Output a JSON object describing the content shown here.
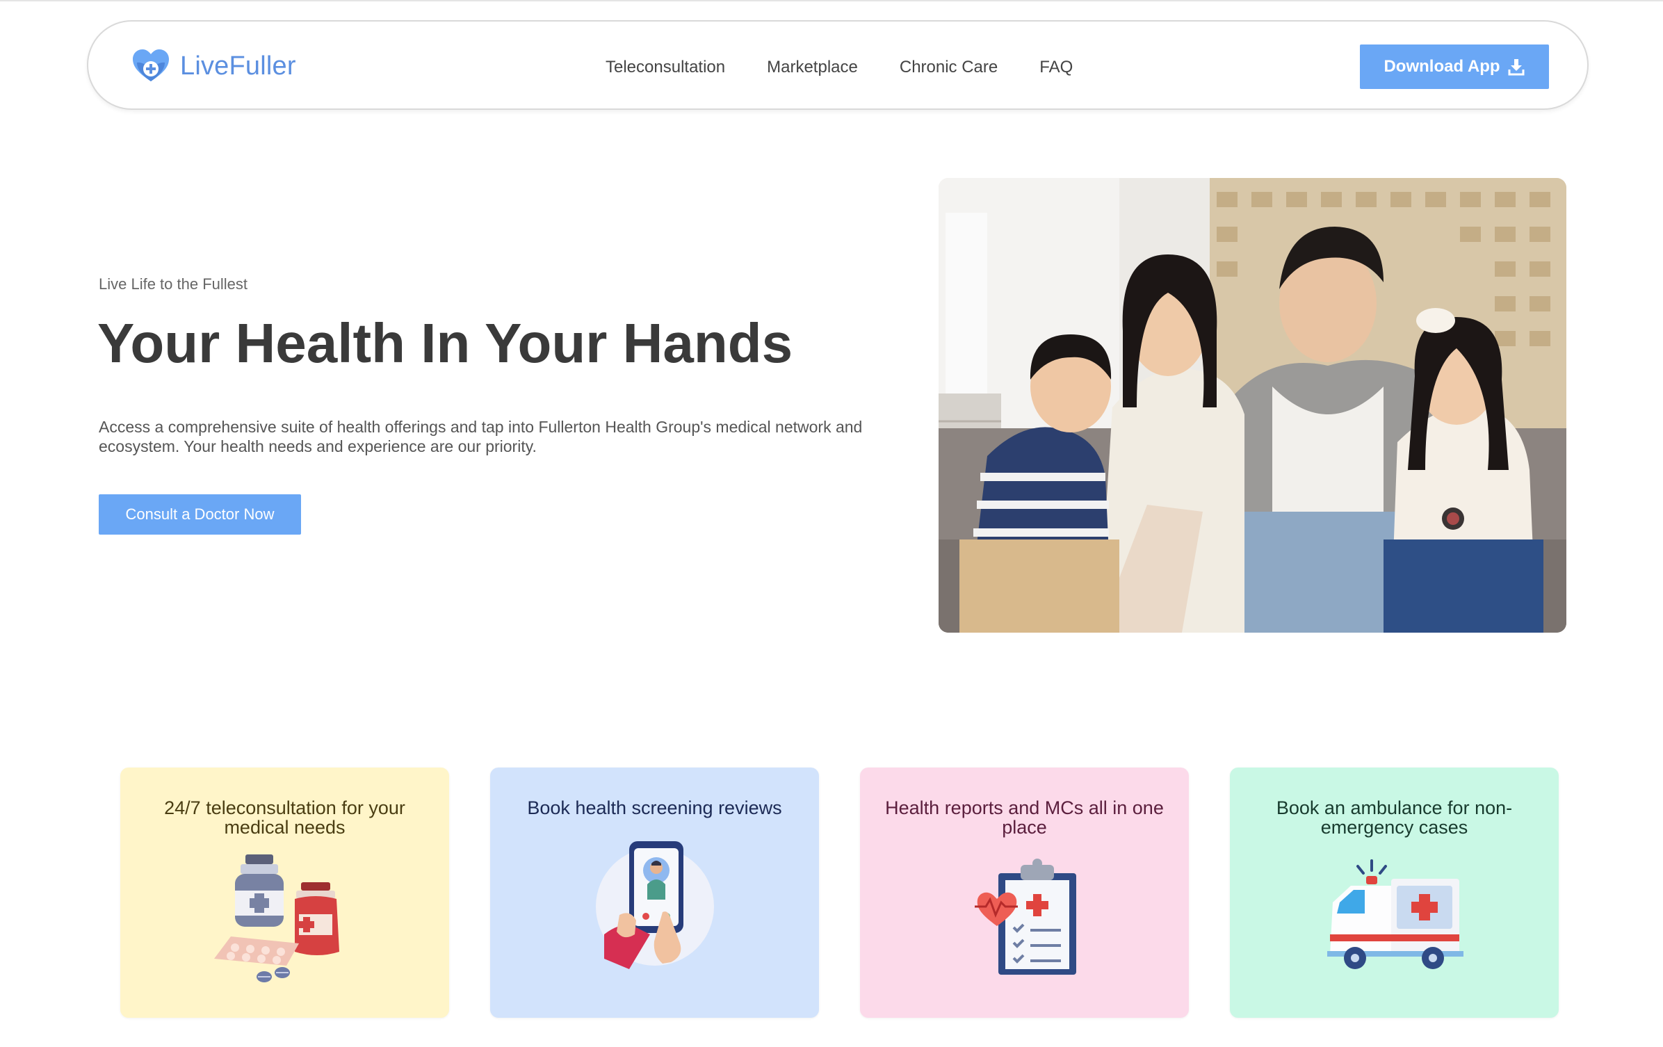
{
  "brand": {
    "name": "LiveFuller",
    "logo_icon": "heart-plus-icon"
  },
  "nav": {
    "links": [
      "Teleconsultation",
      "Marketplace",
      "Chronic Care",
      "FAQ"
    ],
    "download_label": "Download App",
    "download_icon": "download-icon"
  },
  "hero": {
    "eyebrow": "Live Life to the Fullest",
    "title": "Your Health In Your Hands",
    "description": "Access a comprehensive suite of health offerings and tap into Fullerton Health Group's medical network and ecosystem. Your health needs and experience are our priority.",
    "cta_label": "Consult a Doctor Now",
    "image": "family-photo"
  },
  "features": [
    {
      "title": "24/7 teleconsultation for your medical needs",
      "icon": "medicine-bottles-icon",
      "bg": "#fff5c9",
      "color": "#4a3d12"
    },
    {
      "title": "Book health screening reviews",
      "icon": "video-call-doctor-icon",
      "bg": "#d2e3fc",
      "color": "#1c2a55"
    },
    {
      "title": "Health reports and MCs all in one place",
      "icon": "clipboard-report-icon",
      "bg": "#fcdaea",
      "color": "#5b1e3d"
    },
    {
      "title": "Book an ambulance for non-emergency cases",
      "icon": "ambulance-icon",
      "bg": "#c9f8e5",
      "color": "#183b2e"
    }
  ],
  "colors": {
    "accent": "#6aa7f5",
    "logo": "#5b8fe0",
    "heading": "#3a3a3a"
  }
}
